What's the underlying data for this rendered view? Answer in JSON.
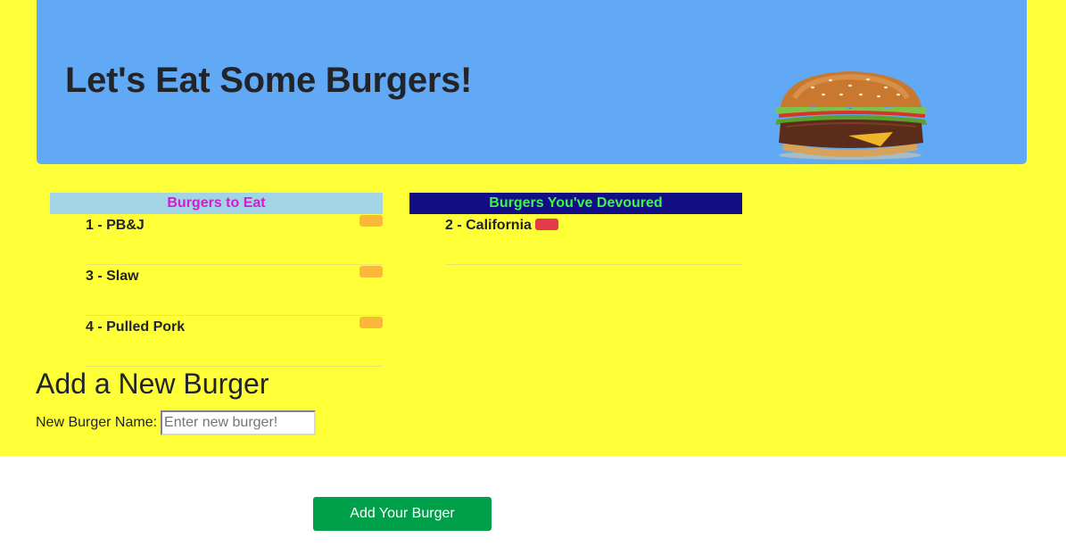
{
  "header": {
    "title": "Let's Eat Some Burgers!",
    "image_icon": "burger-image"
  },
  "to_eat": {
    "heading": "Burgers to Eat",
    "items": [
      {
        "label": "1 - PB&J"
      },
      {
        "label": "3 - Slaw"
      },
      {
        "label": "4 - Pulled Pork"
      }
    ]
  },
  "devoured": {
    "heading": "Burgers You've Devoured",
    "items": [
      {
        "label": "2 - California"
      }
    ]
  },
  "add_form": {
    "heading": "Add a New Burger",
    "name_label": "New Burger Name:",
    "input_value": "",
    "input_placeholder": "Enter new burger!",
    "submit_label": "Add Your Burger"
  },
  "colors": {
    "page_background": "#ffff38",
    "jumbotron": "#62a9f5",
    "to_eat_header_bg": "#a3d4e4",
    "to_eat_header_text": "#d21bd5",
    "devoured_header_bg": "#130d86",
    "devoured_header_text": "#3ef44a",
    "devour_button": "#fbb73a",
    "delete_button": "#e43a4a",
    "submit_button": "#00a04a"
  }
}
